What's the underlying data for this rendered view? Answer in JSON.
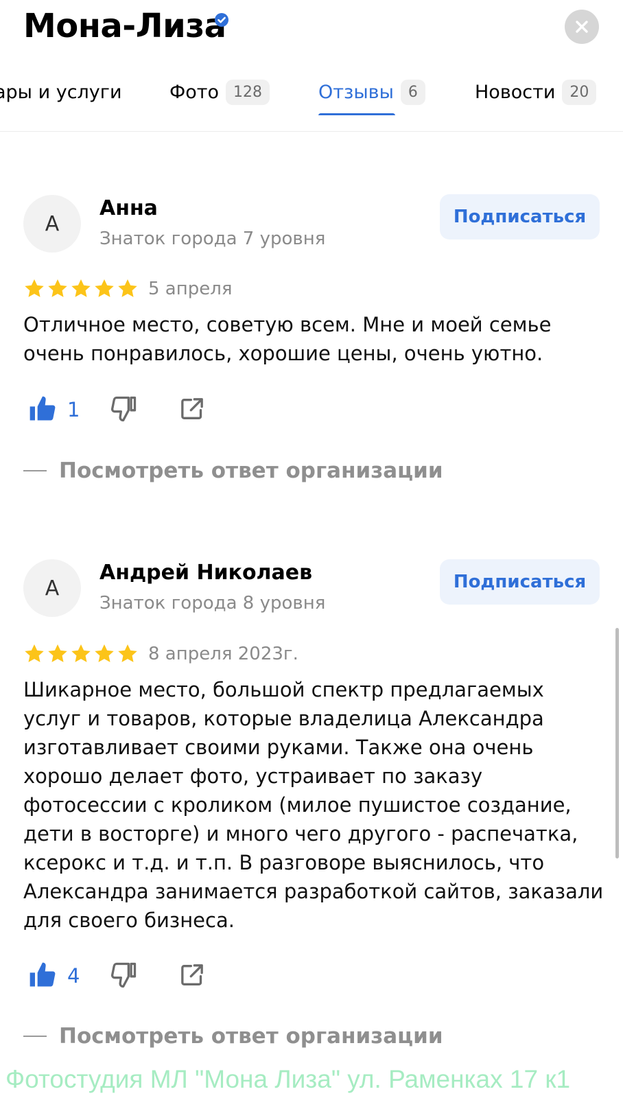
{
  "header": {
    "title": "Мона-Лиза",
    "close_icon": "close-icon",
    "verified_icon": "verified-badge-icon"
  },
  "tabs": [
    {
      "label": "ары и услуги",
      "count": ""
    },
    {
      "label": "Фото",
      "count": "128"
    },
    {
      "label": "Отзывы",
      "count": "6",
      "active": true
    },
    {
      "label": "Новости",
      "count": "20"
    }
  ],
  "reviews": [
    {
      "avatar_letter": "А",
      "author": "Анна",
      "level": "Знаток города 7 уровня",
      "subscribe_label": "Подписаться",
      "rating": 5,
      "date": "5 апреля",
      "text": "Отличное место, советую всем. Мне и моей семье очень понравилось, хорошие цены, очень уютно.",
      "likes": "1",
      "answer_label": "Посмотреть ответ организации"
    },
    {
      "avatar_letter": "А",
      "author": "Андрей Николаев",
      "level": "Знаток города 8 уровня",
      "subscribe_label": "Подписаться",
      "rating": 5,
      "date": "8 апреля 2023г.",
      "text": "Шикарное место, большой спектр предлагаемых услуг и товаров, которые владелица Александра изготавливает своими руками. Также она очень хорошо делает фото, устраивает по заказу фотосессии с кроликом (милое пушистое создание, дети в восторге) и много чего другого - распечатка, ксерокс и т.д. и т.п. В разговоре выяснилось, что Александра занимается разработкой сайтов, заказали для своего бизнеса.",
      "likes": "4",
      "answer_label": "Посмотреть ответ организации"
    }
  ],
  "watermark": "Фотостудия МЛ \"Мона Лиза\" ул. Раменках 17 к1",
  "colors": {
    "accent": "#2f6fd8",
    "star": "#fcc419",
    "watermark": "#a6ecc2"
  }
}
